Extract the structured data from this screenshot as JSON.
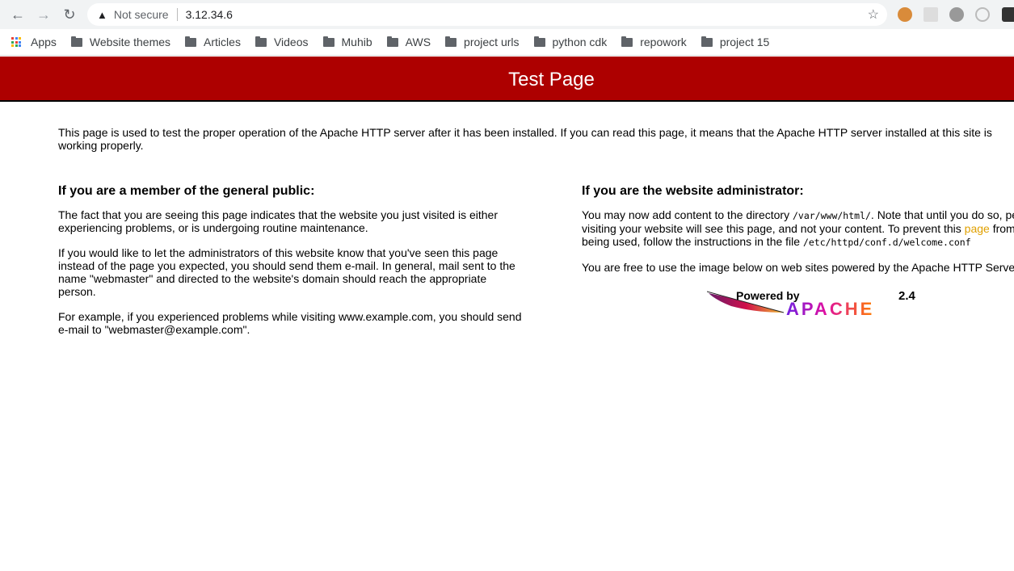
{
  "browser": {
    "security_label": "Not secure",
    "url": "3.12.34.6",
    "bookmarks": [
      {
        "label": "Apps"
      },
      {
        "label": "Website themes"
      },
      {
        "label": "Articles"
      },
      {
        "label": "Videos"
      },
      {
        "label": "Muhib"
      },
      {
        "label": "AWS"
      },
      {
        "label": "project urls"
      },
      {
        "label": "python cdk"
      },
      {
        "label": "repowork"
      },
      {
        "label": "project 15"
      }
    ]
  },
  "page": {
    "title": "Test Page",
    "intro": "This page is used to test the proper operation of the Apache HTTP server after it has been installed. If you can read this page, it means that the Apache HTTP server installed at this site is working properly.",
    "public": {
      "heading": "If you are a member of the general public:",
      "p1": "The fact that you are seeing this page indicates that the website you just visited is either experiencing problems, or is undergoing routine maintenance.",
      "p2": "If you would like to let the administrators of this website know that you've seen this page instead of the page you expected, you should send them e-mail. In general, mail sent to the name \"webmaster\" and directed to the website's domain should reach the appropriate person.",
      "p3": "For example, if you experienced problems while visiting www.example.com, you should send e-mail to \"webmaster@example.com\"."
    },
    "admin": {
      "heading": "If you are the website administrator:",
      "p1a": "You may now add content to the directory ",
      "p1_dir": "/var/www/html/",
      "p1b": ". Note that until you do so, people visiting your website will see this page, and not your content. To prevent this ",
      "p1_link": "page",
      "p1c": " from ever being used, follow the instructions in the file ",
      "p1_file": "/etc/httpd/conf.d/welcome.conf",
      "p2": "You are free to use the image below on web sites powered by the Apache HTTP Server"
    },
    "logo": {
      "powered": "Powered by",
      "version": "2.4",
      "name": "APACHE"
    }
  }
}
